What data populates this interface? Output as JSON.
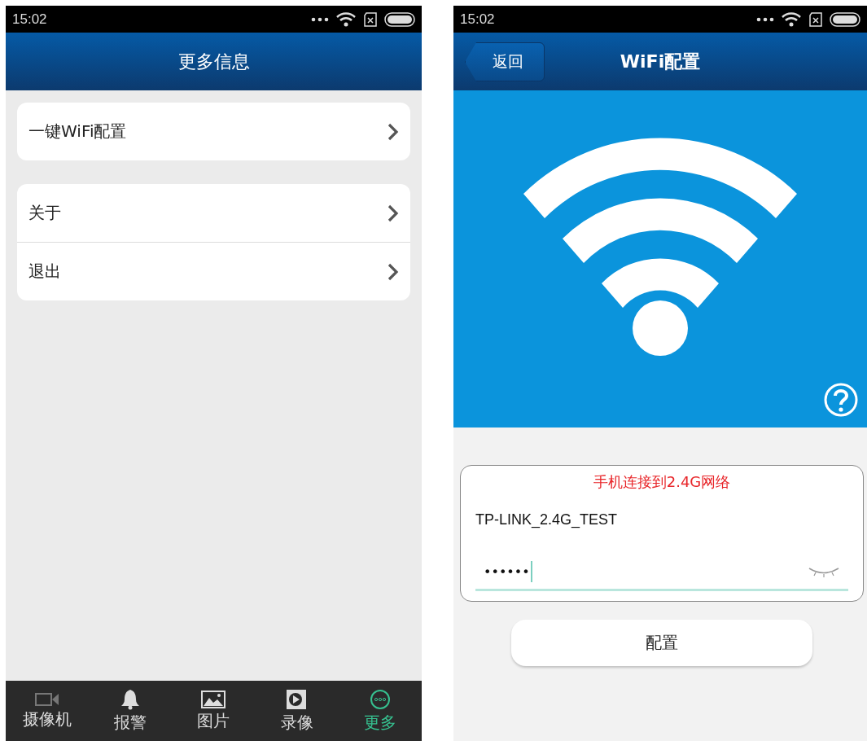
{
  "left_screen": {
    "status_bar": {
      "time": "15:02"
    },
    "header": {
      "title": "更多信息"
    },
    "menu_groups": [
      {
        "items": [
          {
            "label": "一键WiFi配置"
          }
        ]
      },
      {
        "items": [
          {
            "label": "关于"
          },
          {
            "label": "退出"
          }
        ]
      }
    ],
    "tab_bar": [
      {
        "label": "摄像机",
        "kind": "camera",
        "selected": false
      },
      {
        "label": "报警",
        "kind": "bell",
        "selected": false
      },
      {
        "label": "图片",
        "kind": "image",
        "selected": false
      },
      {
        "label": "录像",
        "kind": "video",
        "selected": false
      },
      {
        "label": "更多",
        "kind": "more",
        "selected": true
      }
    ]
  },
  "right_screen": {
    "status_bar": {
      "time": "15:02"
    },
    "header": {
      "back_button": "返回",
      "title": "WiFi配置"
    },
    "form": {
      "message": "手机连接到2.4G网络",
      "ssid": "TP-LINK_2.4G_TEST",
      "password": "••••••"
    },
    "submit_button": "配置"
  }
}
